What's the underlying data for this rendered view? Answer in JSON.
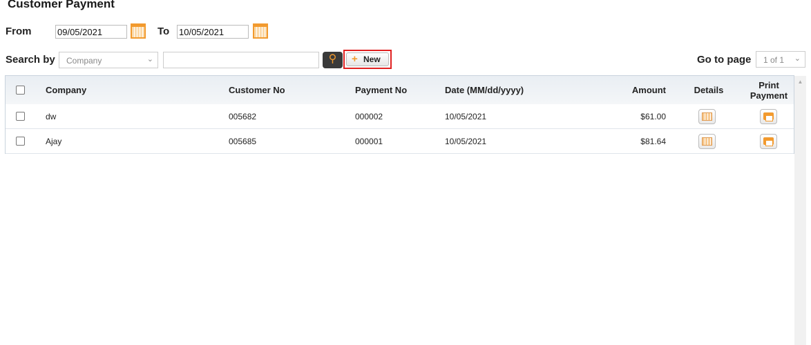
{
  "page_title": "Customer Payment",
  "filters": {
    "from_label": "From",
    "from_value": "09/05/2021",
    "to_label": "To",
    "to_value": "10/05/2021"
  },
  "search": {
    "label": "Search by",
    "field": "Company",
    "query": "",
    "new_label": "New"
  },
  "pager": {
    "label": "Go to page",
    "value": "1 of 1"
  },
  "table": {
    "headers": {
      "company": "Company",
      "customer_no": "Customer No",
      "payment_no": "Payment No",
      "date": "Date (MM/dd/yyyy)",
      "amount": "Amount",
      "details": "Details",
      "print": "Print Payment"
    },
    "rows": [
      {
        "company": "dw",
        "customer_no": "005682",
        "payment_no": "000002",
        "date": "10/05/2021",
        "amount": "$61.00"
      },
      {
        "company": "Ajay",
        "customer_no": "005685",
        "payment_no": "000001",
        "date": "10/05/2021",
        "amount": "$81.64"
      }
    ]
  }
}
